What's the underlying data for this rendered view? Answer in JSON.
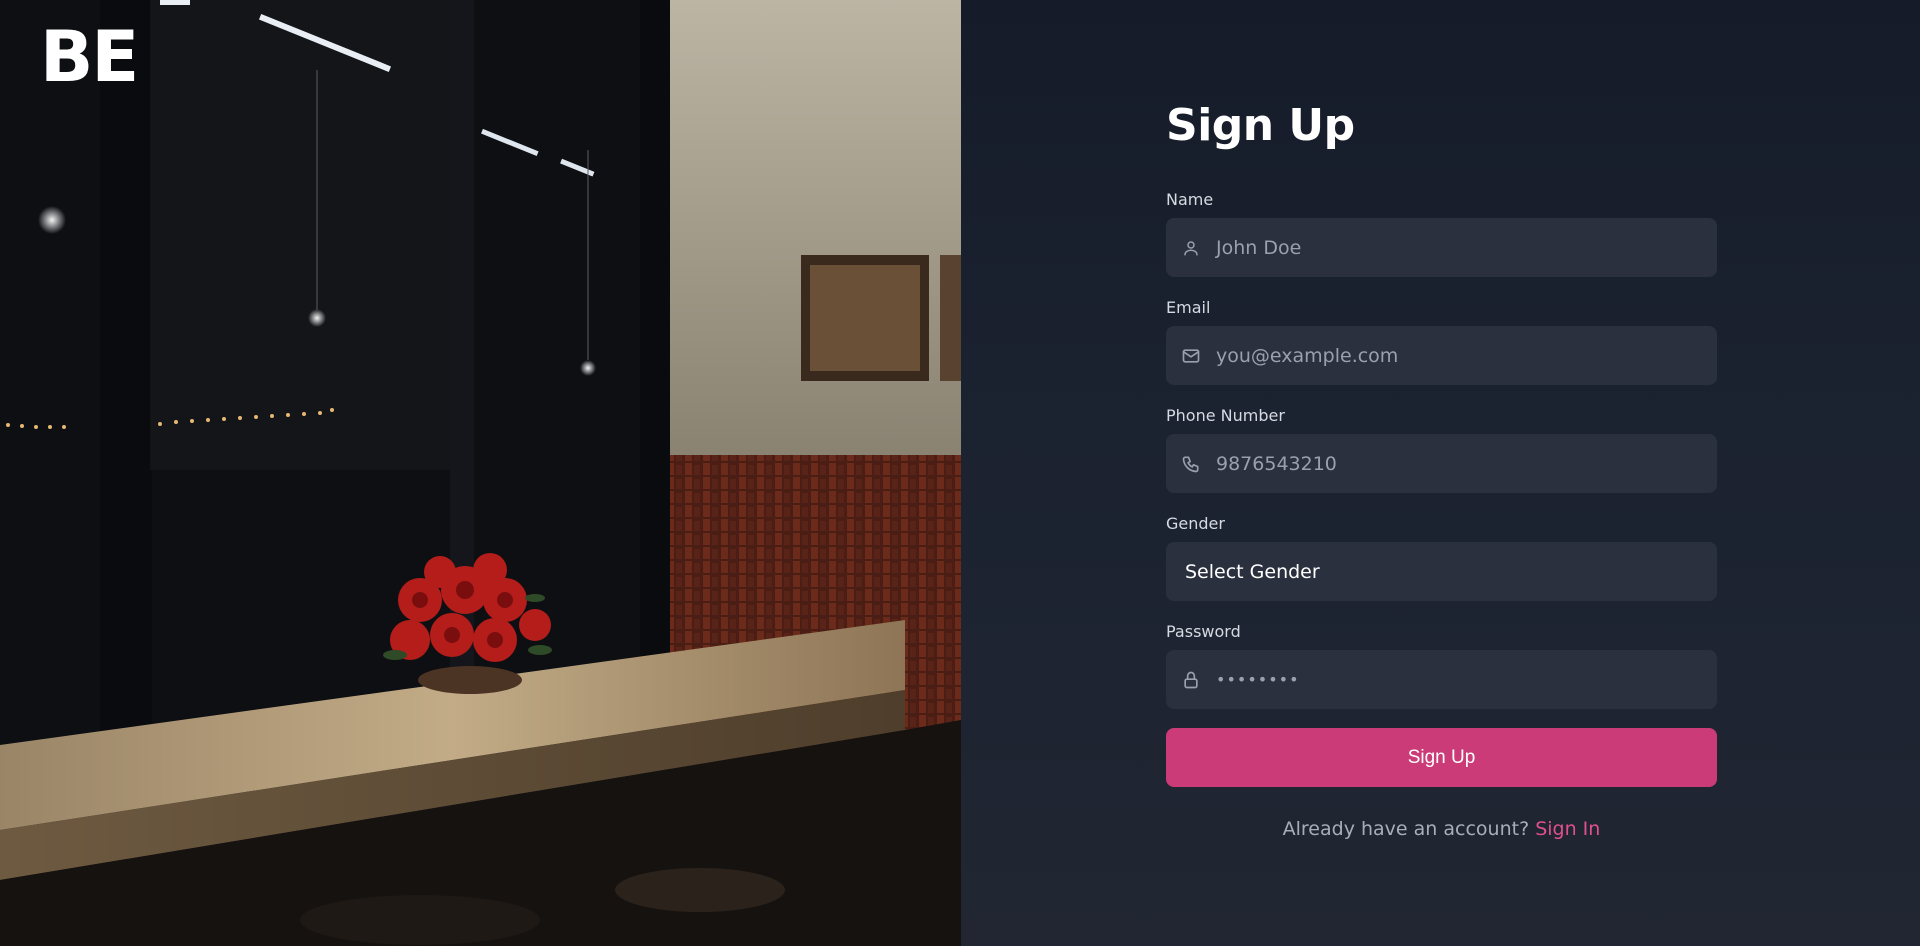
{
  "brand": {
    "logo_text": "BE"
  },
  "form": {
    "title": "Sign Up",
    "name": {
      "label": "Name",
      "placeholder": "John Doe",
      "icon": "user-icon"
    },
    "email": {
      "label": "Email",
      "placeholder": "you@example.com",
      "icon": "mail-icon"
    },
    "phone": {
      "label": "Phone Number",
      "placeholder": "9876543210",
      "icon": "phone-icon"
    },
    "gender": {
      "label": "Gender",
      "selected": "Select Gender"
    },
    "password": {
      "label": "Password",
      "placeholder": "••••••••",
      "icon": "lock-icon"
    },
    "submit_label": "Sign Up",
    "footer": {
      "prompt": "Already have an account?",
      "link": "Sign In"
    }
  },
  "colors": {
    "accent": "#cb3b77",
    "link": "#e0508d",
    "panel_bg": "#1b2230",
    "input_bg": "#2a303d"
  }
}
